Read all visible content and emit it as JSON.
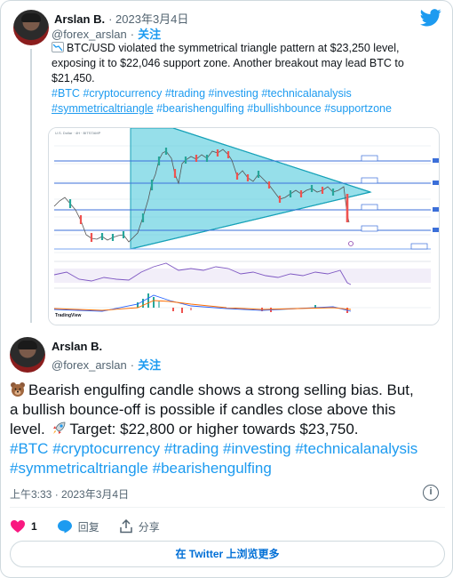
{
  "quoted_tweet": {
    "author_name": "Arslan B.",
    "date": "· 2023年3月4日",
    "handle": "@forex_arslan",
    "follow_sep": "·",
    "follow_label": "关注",
    "text_line1": "BTC/USD violated the symmetrical triangle pattern at $23,250 level,",
    "text_line2": "exposing it to $22,046 support zone. Another breakout may lead BTC to",
    "text_line3": "$21,450.",
    "hashtags_line1": [
      "#BTC",
      "#cryptocurrency",
      "#trading",
      "#investing",
      "#technicalanalysis"
    ],
    "hashtags_line2": [
      "#symmetricaltriangle",
      "#bearishengulfing",
      "#bullishbounce",
      "#supportzone"
    ],
    "chart_header": "U.S. Dollar · 4H · BITSTAMP",
    "chart_brand": "TradingView"
  },
  "main_tweet": {
    "author_name": "Arslan B.",
    "handle": "@forex_arslan",
    "follow_sep": "·",
    "follow_label": "关注",
    "line1": "Bearish engulfing candle shows a strong selling bias. But,",
    "line2": "a bullish bounce-off is possible if candles close above this",
    "line3_a": "level.",
    "line3_b": "Target: $22,800 or higher towards $23,750.",
    "hashtags_line1": [
      "#BTC",
      "#cryptocurrency",
      "#trading",
      "#investing",
      "#technicalanalysis"
    ],
    "hashtags_line2": [
      "#symmetricaltriangle",
      "#bearishengulfing"
    ],
    "timestamp": "上午3:33 · 2023年3月4日"
  },
  "actions": {
    "like_count": "1",
    "reply_label": "回复",
    "share_label": "分享"
  },
  "more_button_label": "在 Twitter 上浏览更多",
  "icons": {
    "brand": "twitter-bird-icon",
    "bear": "bear-emoji",
    "rocket": "rocket-emoji",
    "like": "heart-icon",
    "reply": "reply-bubble-icon",
    "share": "share-icon",
    "info": "info-icon"
  },
  "colors": {
    "accent": "#1d9bf0",
    "link_button": "#006fd6",
    "like": "#f91880",
    "triangle_fill": "#40c4d8",
    "candle_up": "#26a69a",
    "candle_down": "#ef5350"
  }
}
